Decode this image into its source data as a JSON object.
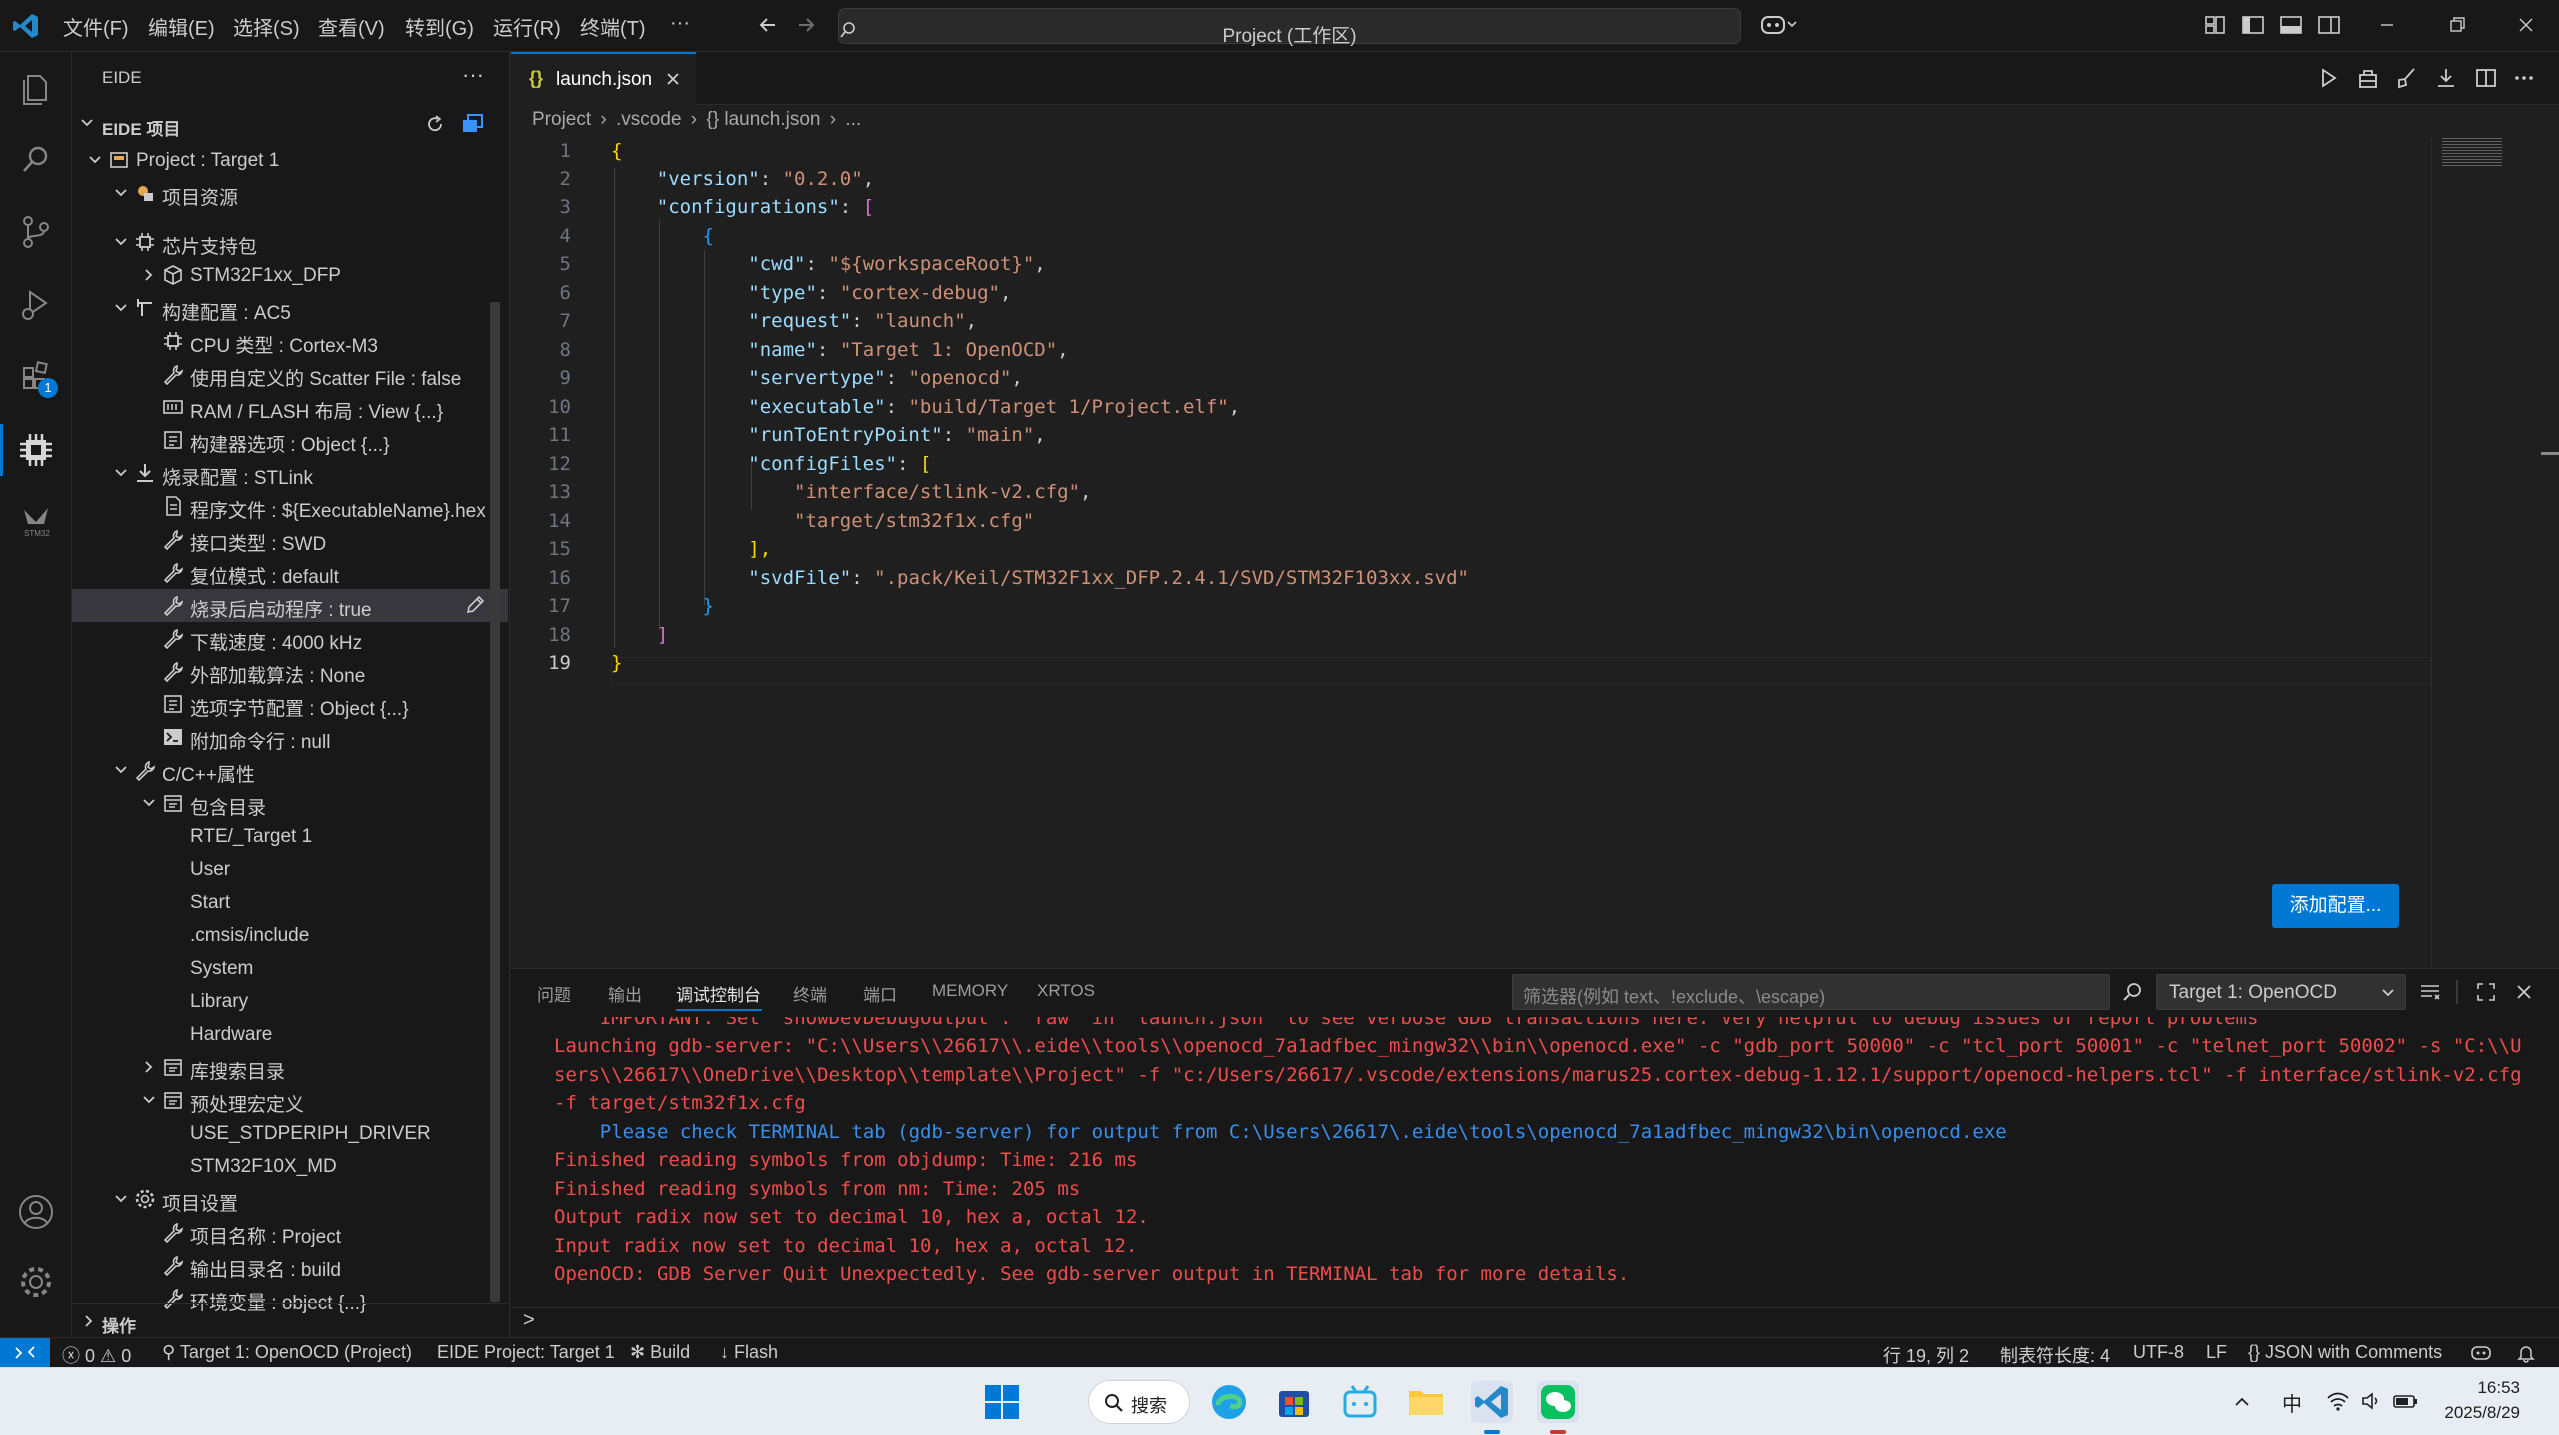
{
  "window": {
    "title": "Project (工作区)",
    "menu": [
      "文件(F)",
      "编辑(E)",
      "选择(S)",
      "查看(V)",
      "转到(G)",
      "运行(R)",
      "终端(T)",
      "···"
    ]
  },
  "activity": {
    "extensions_badge": "1",
    "stm32_label": "STM32"
  },
  "sidebar": {
    "title": "EIDE",
    "more": "···",
    "section": "EIDE 项目",
    "items": [
      {
        "label": "Project : Target 1"
      },
      {
        "label": "项目资源"
      },
      {
        "label": "芯片支持包"
      },
      {
        "label": "STM32F1xx_DFP"
      },
      {
        "label": "构建配置 : AC5"
      },
      {
        "label": "CPU 类型 : Cortex-M3"
      },
      {
        "label": "使用自定义的 Scatter File : false"
      },
      {
        "label": "RAM / FLASH 布局 : View {...}"
      },
      {
        "label": "构建器选项 : Object {...}"
      },
      {
        "label": "烧录配置 : STLink"
      },
      {
        "label": "程序文件 : ${ExecutableName}.hex"
      },
      {
        "label": "接口类型 : SWD"
      },
      {
        "label": "复位模式 : default"
      },
      {
        "label": "烧录后启动程序 : true"
      },
      {
        "label": "下载速度 : 4000 kHz"
      },
      {
        "label": "外部加载算法 : None"
      },
      {
        "label": "选项字节配置 : Object {...}"
      },
      {
        "label": "附加命令行 : null"
      },
      {
        "label": "C/C++属性"
      },
      {
        "label": "包含目录"
      },
      {
        "label": "RTE/_Target 1"
      },
      {
        "label": "User"
      },
      {
        "label": "Start"
      },
      {
        "label": ".cmsis/include"
      },
      {
        "label": "System"
      },
      {
        "label": "Library"
      },
      {
        "label": "Hardware"
      },
      {
        "label": "库搜索目录"
      },
      {
        "label": "预处理宏定义"
      },
      {
        "label": "USE_STDPERIPH_DRIVER"
      },
      {
        "label": "STM32F10X_MD"
      },
      {
        "label": "项目设置"
      },
      {
        "label": "项目名称 : Project"
      },
      {
        "label": "输出目录名 : build"
      },
      {
        "label": "环境变量 : object {...}"
      }
    ],
    "footer": "操作"
  },
  "editor": {
    "tab": {
      "label": "launch.json",
      "icon": "{}"
    },
    "breadcrumb": [
      "Project",
      ".vscode",
      "{} launch.json",
      "..."
    ],
    "line_numbers": [
      "1",
      "2",
      "3",
      "4",
      "5",
      "6",
      "7",
      "8",
      "9",
      "10",
      "11",
      "12",
      "13",
      "14",
      "15",
      "16",
      "17",
      "18",
      "19"
    ],
    "code": {
      "l1": "{",
      "l2k": "\"version\"",
      "l2v": "\"0.2.0\"",
      "l3k": "\"configurations\"",
      "l3v": "[",
      "l5k": "\"cwd\"",
      "l5v": "\"${workspaceRoot}\"",
      "l6k": "\"type\"",
      "l6v": "\"cortex-debug\"",
      "l7k": "\"request\"",
      "l7v": "\"launch\"",
      "l8k": "\"name\"",
      "l8v": "\"Target 1: OpenOCD\"",
      "l9k": "\"servertype\"",
      "l9v": "\"openocd\"",
      "l10k": "\"executable\"",
      "l10v": "\"build/Target 1/Project.elf\"",
      "l11k": "\"runToEntryPoint\"",
      "l11v": "\"main\"",
      "l12k": "\"configFiles\"",
      "l12v": "[",
      "l13v": "\"interface/stlink-v2.cfg\"",
      "l14v": "\"target/stm32f1x.cfg\"",
      "l15": "],",
      "l16k": "\"svdFile\"",
      "l16v": "\".pack/Keil/STM32F1xx_DFP.2.4.1/SVD/STM32F103xx.svd\"",
      "l17": "}",
      "l18": "]",
      "l19": "}"
    },
    "add_config_button": "添加配置..."
  },
  "panel": {
    "tabs": [
      "问题",
      "输出",
      "调试控制台",
      "终端",
      "端口",
      "MEMORY",
      "XRTOS"
    ],
    "filter_placeholder": "筛选器(例如 text、!exclude、\\escape)",
    "session": "Target 1: OpenOCD",
    "output": [
      "    IMPORTANT: Set \"showDevDebugOutput\": \"raw\" in \"launch.json\" to see verbose GDB transactions here. Very helpful to debug issues or report problems",
      "Launching gdb-server: \"C:\\\\Users\\\\26617\\\\.eide\\\\tools\\\\openocd_7a1adfbec_mingw32\\\\bin\\\\openocd.exe\" -c \"gdb_port 50000\" -c \"tcl_port 50001\" -c \"telnet_port 50002\" -s \"C:\\\\U",
      "sers\\\\26617\\\\OneDrive\\\\Desktop\\\\template\\\\Project\" -f \"c:/Users/26617/.vscode/extensions/marus25.cortex-debug-1.12.1/support/openocd-helpers.tcl\" -f interface/stlink-v2.cfg",
      "-f target/stm32f1x.cfg",
      "    Please check TERMINAL tab (gdb-server) for output from C:\\Users\\26617\\.eide\\tools\\openocd_7a1adfbec_mingw32\\bin\\openocd.exe",
      "Finished reading symbols from objdump: Time: 216 ms",
      "Finished reading symbols from nm: Time: 205 ms",
      "Output radix now set to decimal 10, hex a, octal 12.",
      "Input radix now set to decimal 10, hex a, octal 12.",
      "OpenOCD: GDB Server Quit Unexpectedly. See gdb-server output in TERMINAL tab for more details."
    ],
    "prompt": ">"
  },
  "status": {
    "errors": "0",
    "warnings": "0",
    "debug": "Target 1: OpenOCD (Project)",
    "eide": "EIDE Project: Target 1",
    "build": "Build",
    "flash": "Flash",
    "position": "行 19, 列 2",
    "tab_size": "制表符长度: 4",
    "encoding": "UTF-8",
    "eol": "LF",
    "language": "JSON with Comments"
  },
  "taskbar": {
    "search": "搜索",
    "ime": "中",
    "time": "16:53",
    "date": "2025/8/29"
  },
  "colors": {
    "accent": "#0078d4",
    "error_text": "#f14c4c",
    "info_text": "#3b8eea"
  }
}
